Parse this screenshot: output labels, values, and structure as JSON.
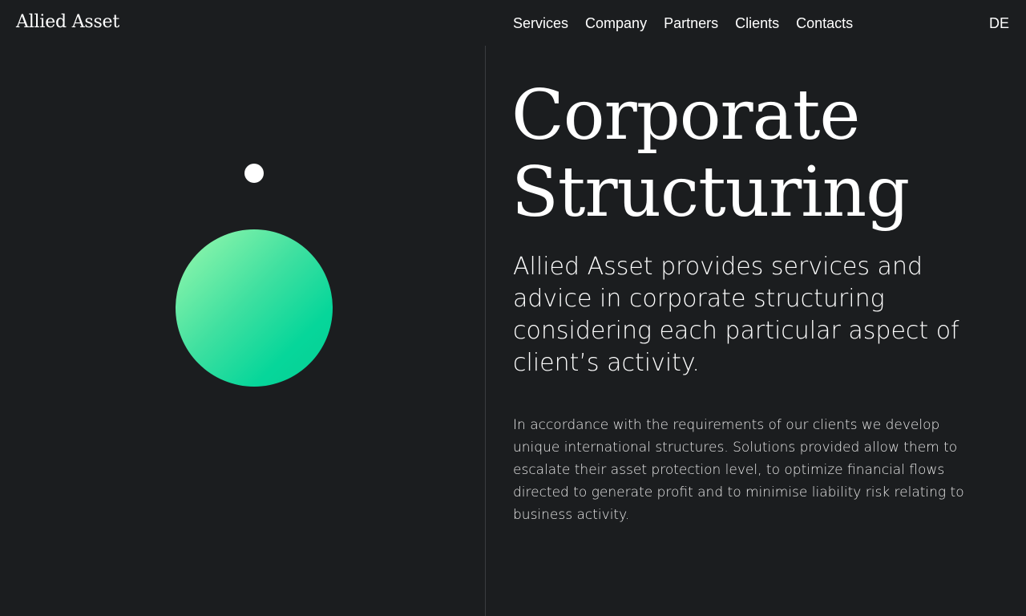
{
  "header": {
    "logo": "Allied Asset",
    "nav": [
      {
        "label": "Services"
      },
      {
        "label": "Company"
      },
      {
        "label": "Partners"
      },
      {
        "label": "Clients"
      },
      {
        "label": "Contacts"
      }
    ],
    "language": "DE"
  },
  "hero": {
    "title_line1": "Corporate",
    "title_line2": "Structuring",
    "lead": "Allied Asset provides services and advice in corporate structuring considering each particular aspect of client’s activity.",
    "body": "In accordance with the requirements of our clients we develop unique international structures. Solutions provided allow them to escalate their asset protection level, to optimize financial flows directed to generate profit and to minimise liability risk relating to business activity."
  },
  "colors": {
    "background": "#1b1d1f",
    "text": "#ffffff",
    "accent_gradient_start": "#9cf9ad",
    "accent_gradient_end": "#05cf94"
  }
}
